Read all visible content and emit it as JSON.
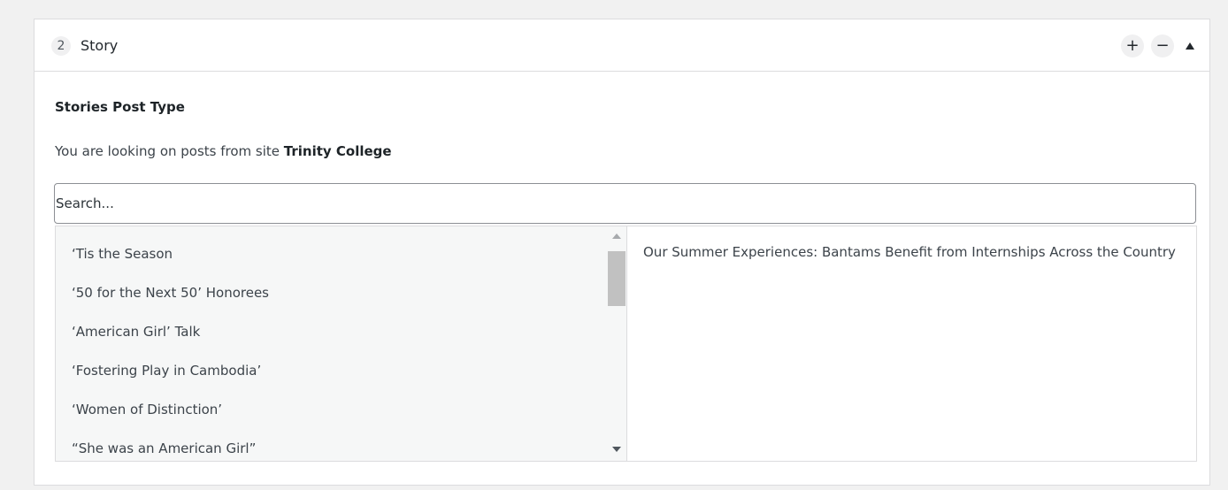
{
  "header": {
    "order": "2",
    "title": "Story",
    "add_label": "+",
    "remove_label": "−"
  },
  "field": {
    "label": "Stories Post Type",
    "description_prefix": "You are looking on posts from site ",
    "site_name": "Trinity College"
  },
  "search": {
    "placeholder": "Search...",
    "value": ""
  },
  "choices": [
    {
      "label": "‘Tis the Season"
    },
    {
      "label": "‘50 for the Next 50’ Honorees"
    },
    {
      "label": "‘American Girl’ Talk"
    },
    {
      "label": "‘Fostering Play in Cambodia’"
    },
    {
      "label": "‘Women of Distinction’"
    },
    {
      "label": "“She was an American Girl”"
    }
  ],
  "selected": [
    {
      "label": "Our Summer Experiences: Bantams Benefit from Internships Across the Country"
    }
  ],
  "icons": {
    "add": "plus-icon",
    "remove": "minus-icon",
    "toggle": "triangle-up-icon",
    "scroll_up": "scroll-up-arrow-icon",
    "scroll_down": "scroll-down-arrow-icon"
  },
  "colors": {
    "background": "#f1f1f1",
    "panel": "#ffffff",
    "border": "#dcdcde",
    "list_background": "#f6f7f7",
    "text": "#23282d"
  }
}
